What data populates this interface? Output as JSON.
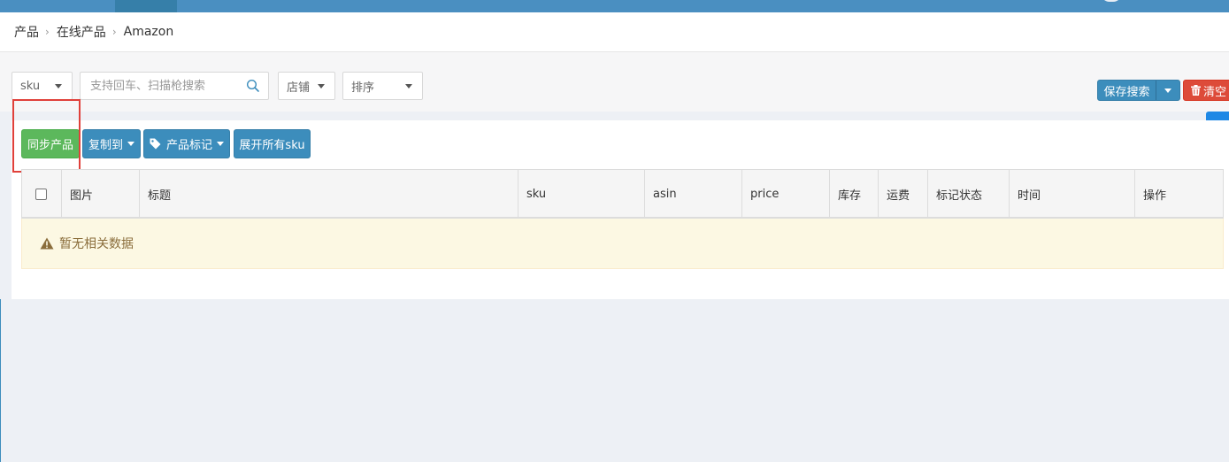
{
  "breadcrumb": {
    "items": [
      "产品",
      "在线产品",
      "Amazon"
    ],
    "separator": "›"
  },
  "filters": {
    "field_select": "sku",
    "search_placeholder": "支持回车、扫描枪搜索",
    "shop_select": "店铺",
    "sort_select": "排序"
  },
  "search_actions": {
    "save_label": "保存搜索",
    "clear_label": "清空"
  },
  "toolbar": {
    "sync_label": "同步产品",
    "copy_label": "复制到",
    "tag_label": "产品标记",
    "expand_label": "展开所有sku"
  },
  "table": {
    "headers": [
      "图片",
      "标题",
      "sku",
      "asin",
      "price",
      "库存",
      "运费",
      "标记状态",
      "时间",
      "操作"
    ],
    "empty_message": "暂无相关数据"
  },
  "colors": {
    "topbar": "#4a8fc1",
    "primary": "#3c8dbc",
    "success": "#5cb85c",
    "danger": "#dd4b39",
    "warning_bg": "#fcf8e3",
    "warning_text": "#8a6d3b",
    "highlight": "#e0403a"
  },
  "icons": [
    "search-icon",
    "tag-icon",
    "trash-icon",
    "warning-icon",
    "user-icon",
    "chevron-down-icon"
  ]
}
